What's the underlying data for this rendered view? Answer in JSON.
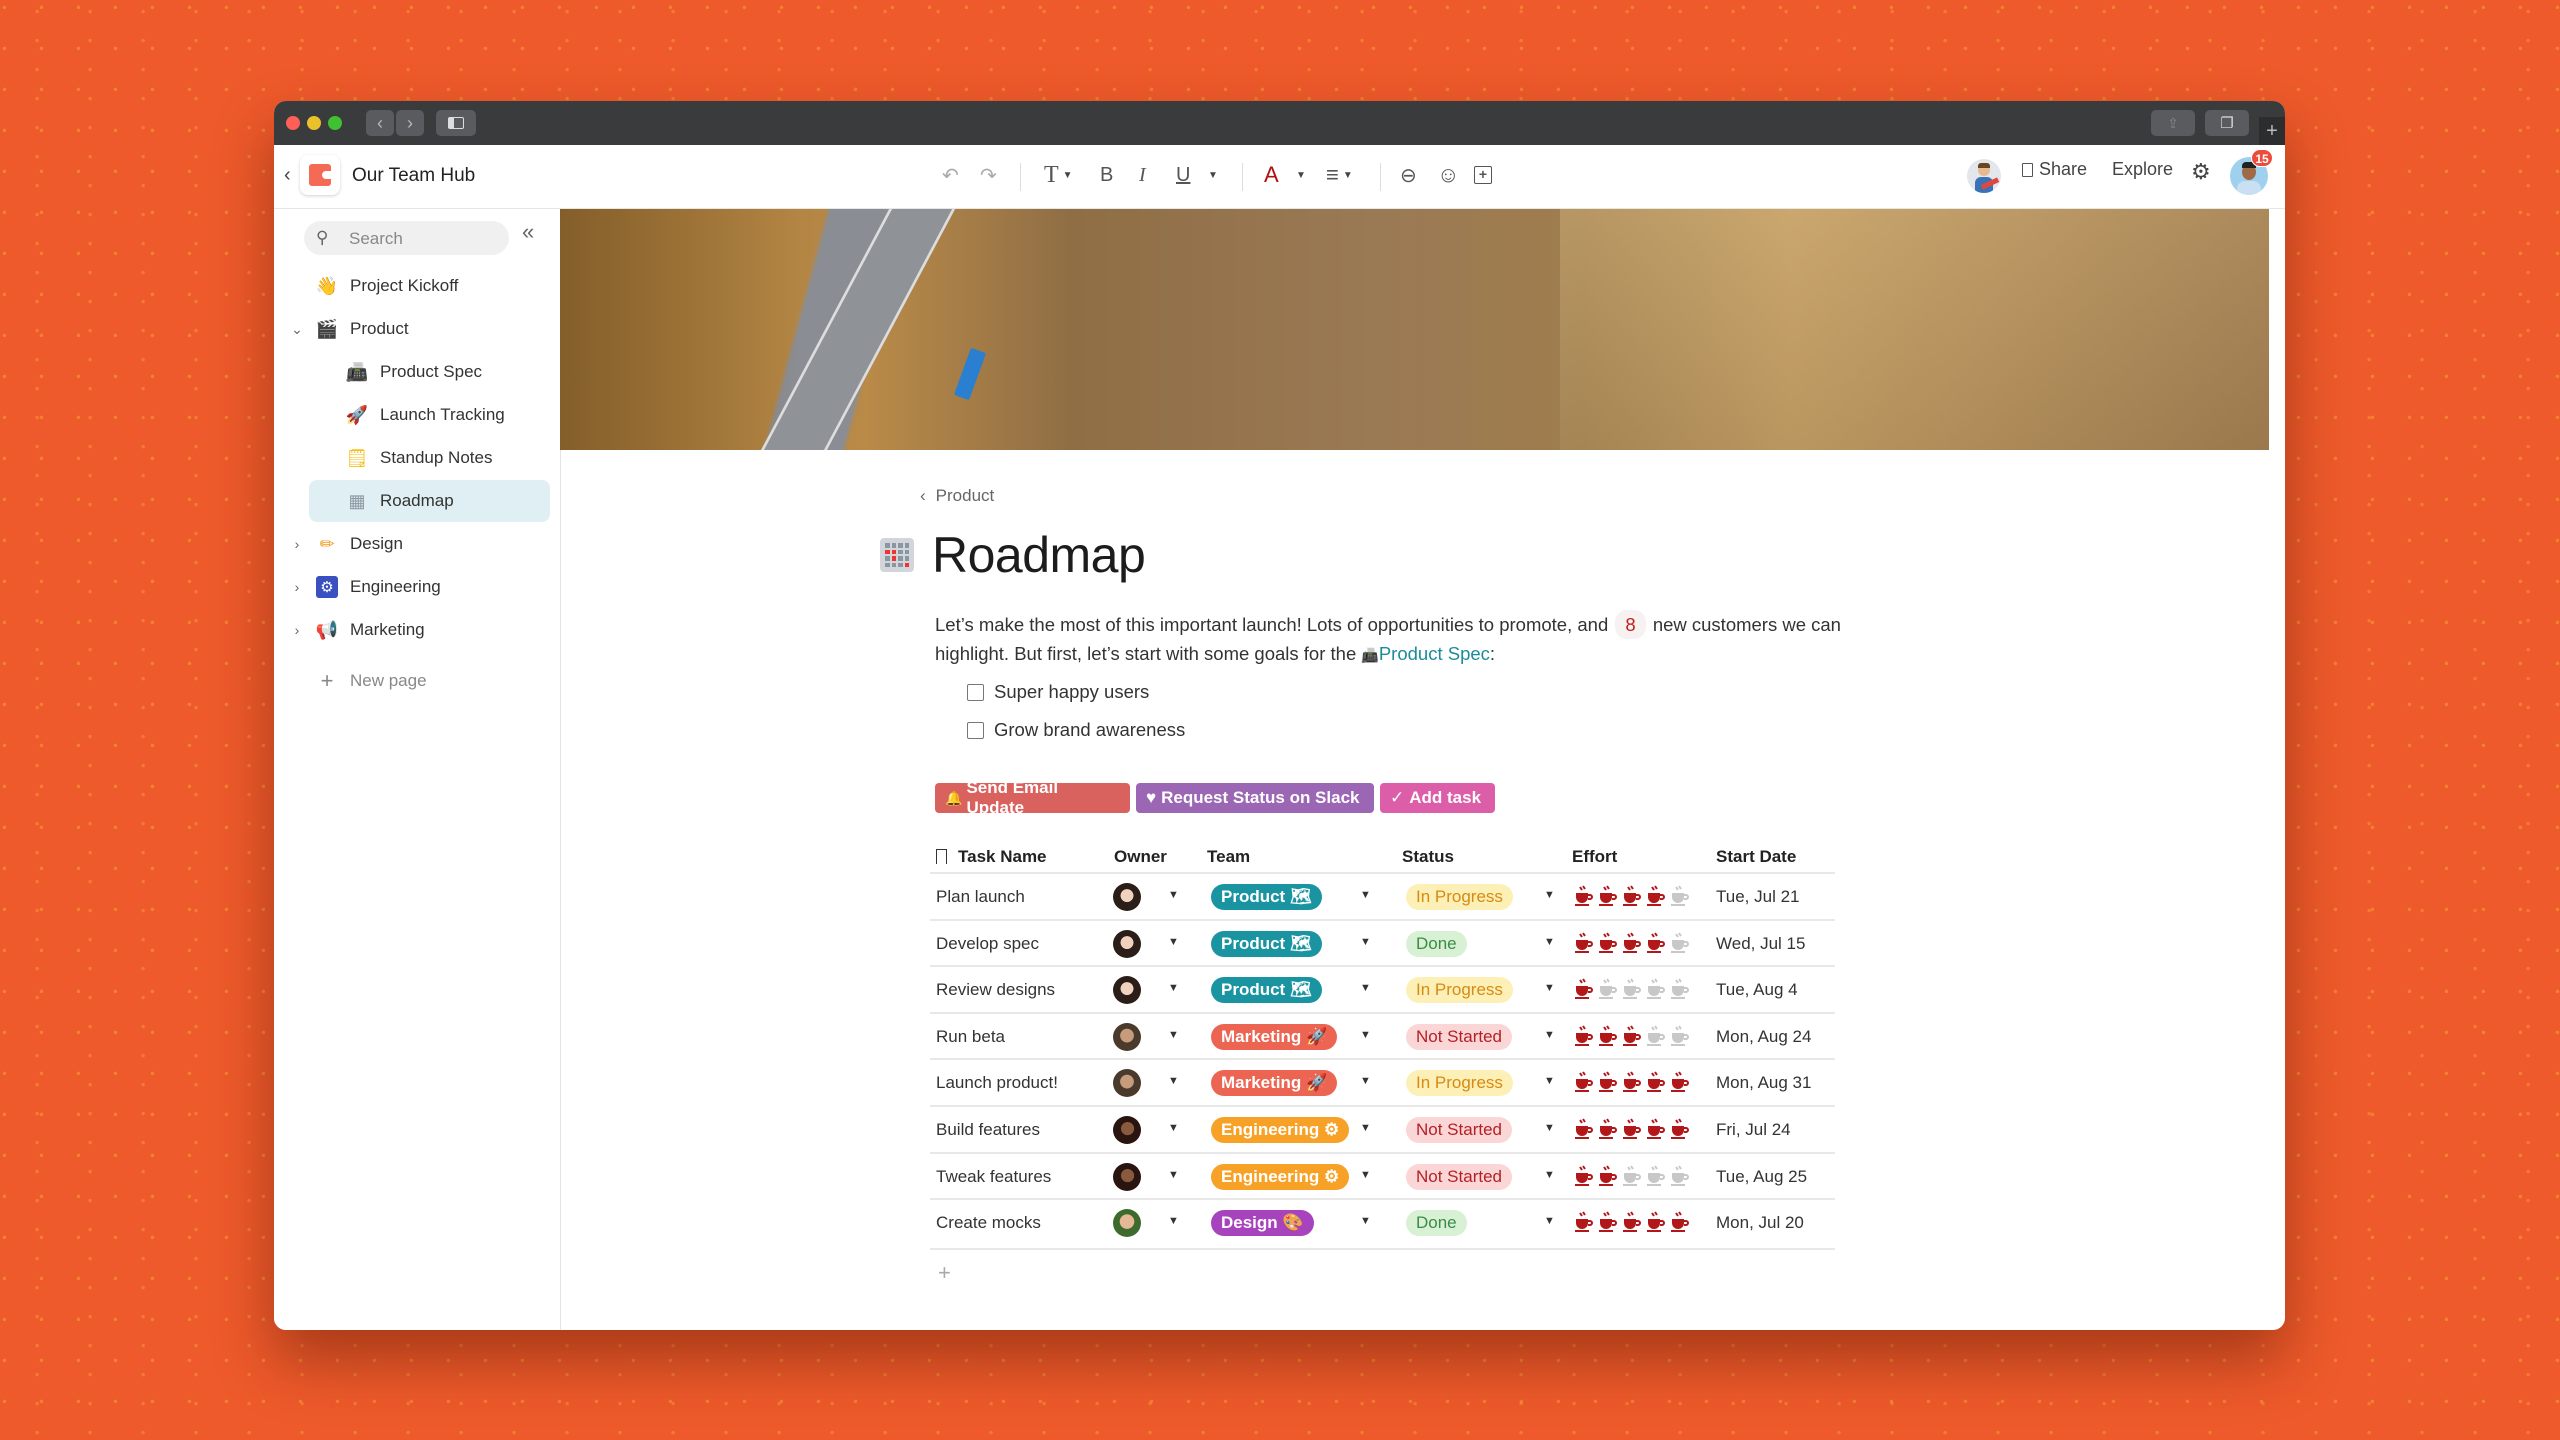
{
  "app": {
    "title": "Our Team Hub",
    "toolbar": {
      "undo": "↶",
      "redo": "↷",
      "text_style": "T",
      "bold": "B",
      "italic": "I",
      "underline": "U",
      "font_color": "A",
      "align": "≡",
      "link_icon": "⊖",
      "emoji_icon": "☺",
      "comment_icon": "+"
    },
    "share_label": "Share",
    "explore_label": "Explore",
    "notification_count": "15"
  },
  "sidebar": {
    "search_placeholder": "Search",
    "collapse_icon": "«",
    "items": [
      {
        "label": "Project Kickoff",
        "emoji": "👋",
        "chevron": ""
      },
      {
        "label": "Product",
        "emoji": "🎬",
        "chevron": "⌄"
      },
      {
        "label": "Product Spec",
        "emoji": "📠",
        "chevron": ""
      },
      {
        "label": "Launch Tracking",
        "emoji": "🚀",
        "chevron": ""
      },
      {
        "label": "Standup Notes",
        "emoji": "🗒",
        "chevron": ""
      },
      {
        "label": "Roadmap",
        "emoji": "▦",
        "chevron": ""
      },
      {
        "label": "Design",
        "emoji": "✏",
        "chevron": "›"
      },
      {
        "label": "Engineering",
        "emoji": "⚙",
        "chevron": "›"
      },
      {
        "label": "Marketing",
        "emoji": "📢",
        "chevron": "›"
      }
    ],
    "new_page_label": "New page"
  },
  "page": {
    "breadcrumb": "Product",
    "title": "Roadmap",
    "intro_part1": "Let’s make the most of this important launch! Lots of opportunities to promote, and",
    "customer_count": "8",
    "intro_part2": "new customers we can highlight. But first, let’s start with some goals for the",
    "link_label": "Product Spec",
    "intro_end": ":",
    "goals": [
      "Super happy users",
      "Grow brand awareness"
    ],
    "buttons": [
      {
        "label": "Send Email Update",
        "icon": "🔔",
        "color": "#d9625f"
      },
      {
        "label": "Request Status on Slack",
        "icon": "♥",
        "color": "#9b67b4"
      },
      {
        "label": "Add task",
        "icon": "✓",
        "color": "#dd5ea8"
      }
    ]
  },
  "table": {
    "columns": [
      "Task Name",
      "Owner",
      "Team",
      "Status",
      "Effort",
      "Start Date"
    ],
    "effort_max": 5,
    "rows": [
      {
        "task": "Plan launch",
        "owner": "woman-1",
        "team": "Product 🗺",
        "team_color": "#1b94a2",
        "status": "In Progress",
        "effort": 4,
        "start": "Tue, Jul 21"
      },
      {
        "task": "Develop spec",
        "owner": "woman-1",
        "team": "Product 🗺",
        "team_color": "#1b94a2",
        "status": "Done",
        "effort": 4,
        "start": "Wed, Jul 15"
      },
      {
        "task": "Review designs",
        "owner": "woman-1",
        "team": "Product 🗺",
        "team_color": "#1b94a2",
        "status": "In Progress",
        "effort": 1,
        "start": "Tue, Aug 4"
      },
      {
        "task": "Run beta",
        "owner": "man-beard",
        "team": "Marketing 🚀",
        "team_color": "#ec6553",
        "status": "Not Started",
        "effort": 3,
        "start": "Mon, Aug 24"
      },
      {
        "task": "Launch product!",
        "owner": "man-beard",
        "team": "Marketing 🚀",
        "team_color": "#ec6553",
        "status": "In Progress",
        "effort": 5,
        "start": "Mon, Aug 31"
      },
      {
        "task": "Build features",
        "owner": "woman-2",
        "team": "Engineering ⚙",
        "team_color": "#f7a126",
        "status": "Not Started",
        "effort": 5,
        "start": "Fri, Jul 24"
      },
      {
        "task": "Tweak features",
        "owner": "woman-2",
        "team": "Engineering ⚙",
        "team_color": "#f7a126",
        "status": "Not Started",
        "effort": 2,
        "start": "Tue, Aug 25"
      },
      {
        "task": "Create mocks",
        "owner": "man-2",
        "team": "Design 🎨",
        "team_color": "#a744bd",
        "status": "Done",
        "effort": 5,
        "start": "Mon, Jul 20"
      }
    ],
    "status_styles": {
      "In Progress": {
        "bg": "#fdf0b6",
        "fg": "#d88a12"
      },
      "Done": {
        "bg": "#d8f0d4",
        "fg": "#3a8c47"
      },
      "Not Started": {
        "bg": "#fbd6d6",
        "fg": "#b52025"
      }
    },
    "add_row_icon": "+"
  }
}
